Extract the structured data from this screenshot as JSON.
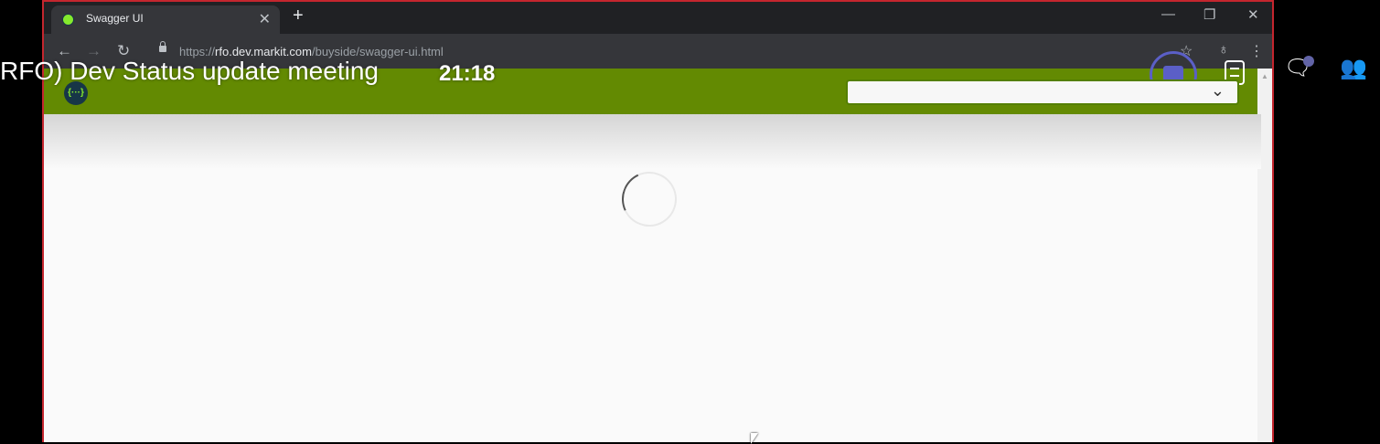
{
  "meeting": {
    "title": "RFO) Dev Status update meeting",
    "timer": "21:18"
  },
  "browser": {
    "tab_title": "Swagger UI",
    "tab_close": "✕",
    "new_tab": "+",
    "url_scheme": "https://",
    "url_host": "rfo.dev.markit.com",
    "url_path": "/buyside/swagger-ui.html",
    "window_controls": {
      "minimize": "—",
      "restore": "❐",
      "close": "✕"
    },
    "nav": {
      "back": "←",
      "forward": "→",
      "reload": "↻"
    },
    "toolbar_icons": {
      "star": "☆",
      "extension": "♁",
      "menu": "⋮"
    }
  },
  "swagger": {
    "logo_text": "{···}",
    "spec_select_value": ""
  },
  "teams_controls": {
    "chat": "🗨",
    "people": "👥"
  },
  "colors": {
    "swagger_green": "#89bf04",
    "share_border": "#c4262e",
    "teams_accent": "#5b5fc7"
  }
}
